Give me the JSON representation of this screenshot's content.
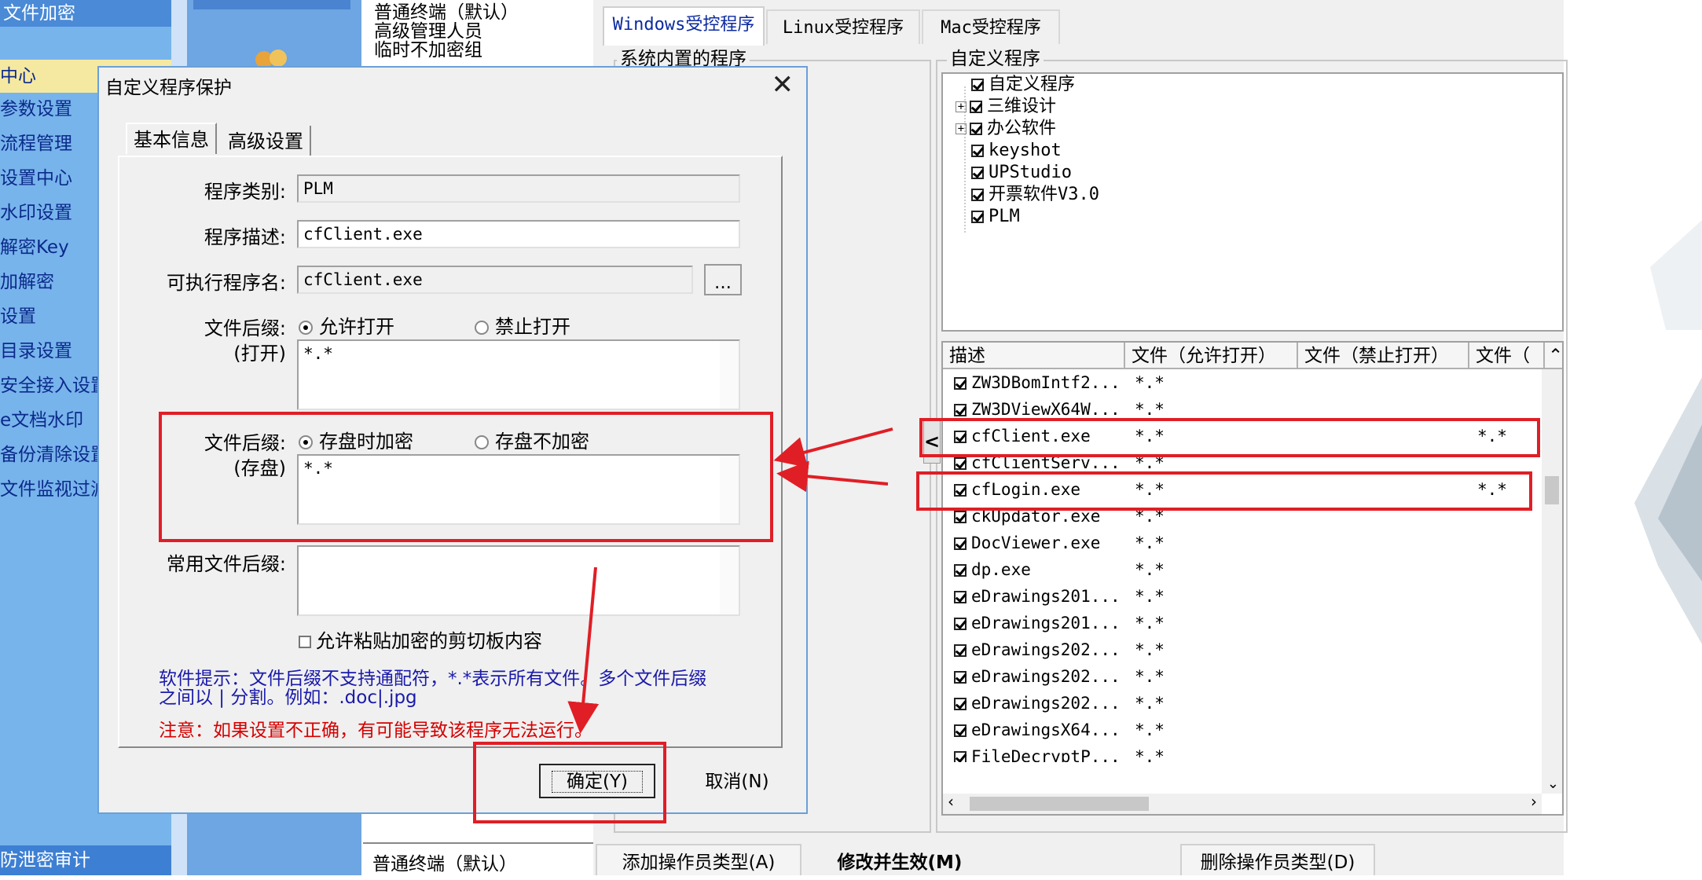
{
  "sidebar": {
    "header": "文件加密",
    "items": [
      "中心",
      "参数设置",
      "流程管理",
      "设置中心",
      "水印设置",
      "解密Key",
      "加解密",
      "设置",
      "目录设置",
      "安全接入设置",
      "e文档水印",
      "备份清除设置",
      "文件监视过滤"
    ],
    "footer": "防泄密审计"
  },
  "operator_list": {
    "items": [
      "普通终端（默认）",
      "高级管理人员",
      "临时不加密组"
    ],
    "bottom_item": "普通终端（默认）"
  },
  "tabs": [
    "Windows受控程序",
    "Linux受控程序",
    "Mac受控程序"
  ],
  "system_group_label": "系统内置的程序",
  "custom_group_label": "自定义程序",
  "tree": [
    {
      "label": "自定义程序",
      "expandable": false,
      "checked": true
    },
    {
      "label": "三维设计",
      "expandable": true,
      "checked": true
    },
    {
      "label": "办公软件",
      "expandable": true,
      "checked": true
    },
    {
      "label": "keyshot",
      "expandable": false,
      "checked": true
    },
    {
      "label": "UPStudio",
      "expandable": false,
      "checked": true
    },
    {
      "label": "开票软件V3.0",
      "expandable": false,
      "checked": true
    },
    {
      "label": "PLM",
      "expandable": false,
      "checked": true
    }
  ],
  "list_headers": [
    "描述",
    "文件（允许打开）",
    "文件（禁止打开）",
    "文件（"
  ],
  "list_rows": [
    {
      "name": "ZW3DBomIntf2...",
      "allow": "*.*",
      "deny": ""
    },
    {
      "name": "ZW3DViewX64W...",
      "allow": "*.*",
      "deny": ""
    },
    {
      "name": "cfClient.exe",
      "allow": "*.*",
      "deny": "*.*"
    },
    {
      "name": "cfClientServ...",
      "allow": "*.*",
      "deny": ""
    },
    {
      "name": "cfLogin.exe",
      "allow": "*.*",
      "deny": "*.*"
    },
    {
      "name": "ckUpdator.exe",
      "allow": "*.*",
      "deny": ""
    },
    {
      "name": "DocViewer.exe",
      "allow": "*.*",
      "deny": ""
    },
    {
      "name": "dp.exe",
      "allow": "*.*",
      "deny": ""
    },
    {
      "name": "eDrawings201...",
      "allow": "*.*",
      "deny": ""
    },
    {
      "name": "eDrawings201...",
      "allow": "*.*",
      "deny": ""
    },
    {
      "name": "eDrawings202...",
      "allow": "*.*",
      "deny": ""
    },
    {
      "name": "eDrawings202...",
      "allow": "*.*",
      "deny": ""
    },
    {
      "name": "eDrawings202...",
      "allow": "*.*",
      "deny": ""
    },
    {
      "name": "eDrawingsX64...",
      "allow": "*.*",
      "deny": ""
    },
    {
      "name": "FileDecryptP...",
      "allow": "*.*",
      "deny": ""
    }
  ],
  "move_button": "<",
  "bottom_buttons": [
    "添加操作员类型(A)",
    "修改并生效(M)",
    "删除操作员类型(D)"
  ],
  "dialog": {
    "title": "自定义程序保护",
    "close": "✕",
    "tabs": [
      "基本信息",
      "高级设置"
    ],
    "fields": {
      "category_label": "程序类别:",
      "category_value": "PLM",
      "desc_label": "程序描述:",
      "desc_value": "cfClient.exe",
      "exe_label": "可执行程序名:",
      "exe_value": "cfClient.exe",
      "browse": "...",
      "open_label_1": "文件后缀:",
      "open_label_2": "(打开)",
      "open_allow": "允许打开",
      "open_deny": "禁止打开",
      "open_value": "*.*",
      "save_label_1": "文件后缀:",
      "save_label_2": "(存盘)",
      "save_encrypt": "存盘时加密",
      "save_noencrypt": "存盘不加密",
      "save_value": "*.*",
      "common_label": "常用文件后缀:",
      "common_value": "",
      "clipboard": "允许粘贴加密的剪切板内容"
    },
    "hint_1": "软件提示：文件后缀不支持通配符，*.*表示所有文件。多个文件后缀",
    "hint_2": "之间以 | 分割。例如：.doc|.jpg",
    "warning": "注意：如果设置不正确，有可能导致该程序无法运行。",
    "ok": "确定(Y)",
    "cancel": "取消(N)"
  },
  "colors": {
    "sidebar": "#78b4ec",
    "annotation": "#e01e26",
    "hint": "#1a1aaa",
    "warning": "#d40000"
  }
}
